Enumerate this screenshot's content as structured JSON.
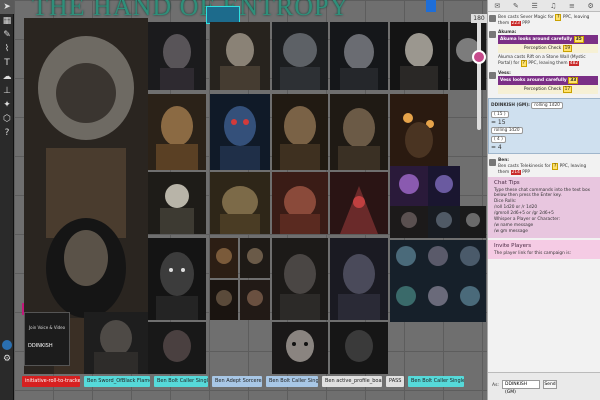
{
  "canvas": {
    "title": "THE HAND OF ENTROPY",
    "zoom_top": "180"
  },
  "video": {
    "label": "Join Voice & Video",
    "name": "DDINKISH"
  },
  "macros": [
    {
      "label": "initiative-roll-to-tracker",
      "color": "#d62020"
    },
    {
      "label": "Ben Sword_OfBlack Flame Strike",
      "color": "#56d9d9"
    },
    {
      "label": "Ben Bolt Caller Single Attack",
      "color": "#56d9d9"
    },
    {
      "label": "Ben Adept Sorcerer Spell",
      "color": "#a8c7e6"
    },
    {
      "label": "Ben Bolt Caller Single Attack",
      "color": "#a8c7e6"
    },
    {
      "label": "Ben active_profile_boasts_damage_range_single",
      "color": "#e0e0e0"
    },
    {
      "label": "PASS",
      "color": "#e0e0e0"
    },
    {
      "label": "Ben Bolt Caller Single Attack",
      "color": "#56d9d9"
    }
  ],
  "chat": {
    "msg1_text": "Ben casts Sever Magic for",
    "msg1_rest": "PPC, leaving them",
    "msg1_num": "223",
    "msg1_tail": "PPP",
    "akuma_name": "Akuma:",
    "akuma_head": "Akuma looks around carefully",
    "akuma_num": "35",
    "akuma_check": "Perception Check",
    "akuma_check_val": "19",
    "akuma_cast": "Akuma casts Rift on a Stone Wall (Mystic Portal) for",
    "akuma_cast_rest": "PPC, leaving them",
    "akuma_cast_num": "482",
    "vess_name": "Vess:",
    "vess_head": "Vess looks around carefully",
    "vess_num": "33",
    "vess_check": "Perception Check",
    "vess_check_val": "17",
    "dice_user": "DDINKISH (GM):",
    "dice_cmd": "rolling 1d20",
    "roll1": "( 15 )",
    "roll1_total": "= 15",
    "dice_cmd2": "rolling 1d20",
    "roll2": "( 4 )",
    "roll2_total": "= 4",
    "ben_name": "Ben:",
    "ben_text": "Ben casts Telekinesis for",
    "ben_rest": "PPC, leaving them",
    "ben_num": "214",
    "ben_tail": "PPP"
  },
  "tips": {
    "title": "Chat Tips",
    "intro": "Type these chat commands into the text box below then press the Enter key.",
    "dice": "Dice Rolls:",
    "roll_a": "/roll 1d20 or /r 1d20",
    "roll_b": "/gmroll 2d6+5 or /gr 2d6+5",
    "whisper": "Whisper a Player or Character:",
    "whisper_a": "/w name message",
    "whisper_b": "/w gm message"
  },
  "invite": {
    "title": "Invite Players",
    "text": "The player link for this campaign is:"
  },
  "input": {
    "as_label": "As:",
    "as_value": "DDINKISH (GM)",
    "send_label": "Send"
  }
}
